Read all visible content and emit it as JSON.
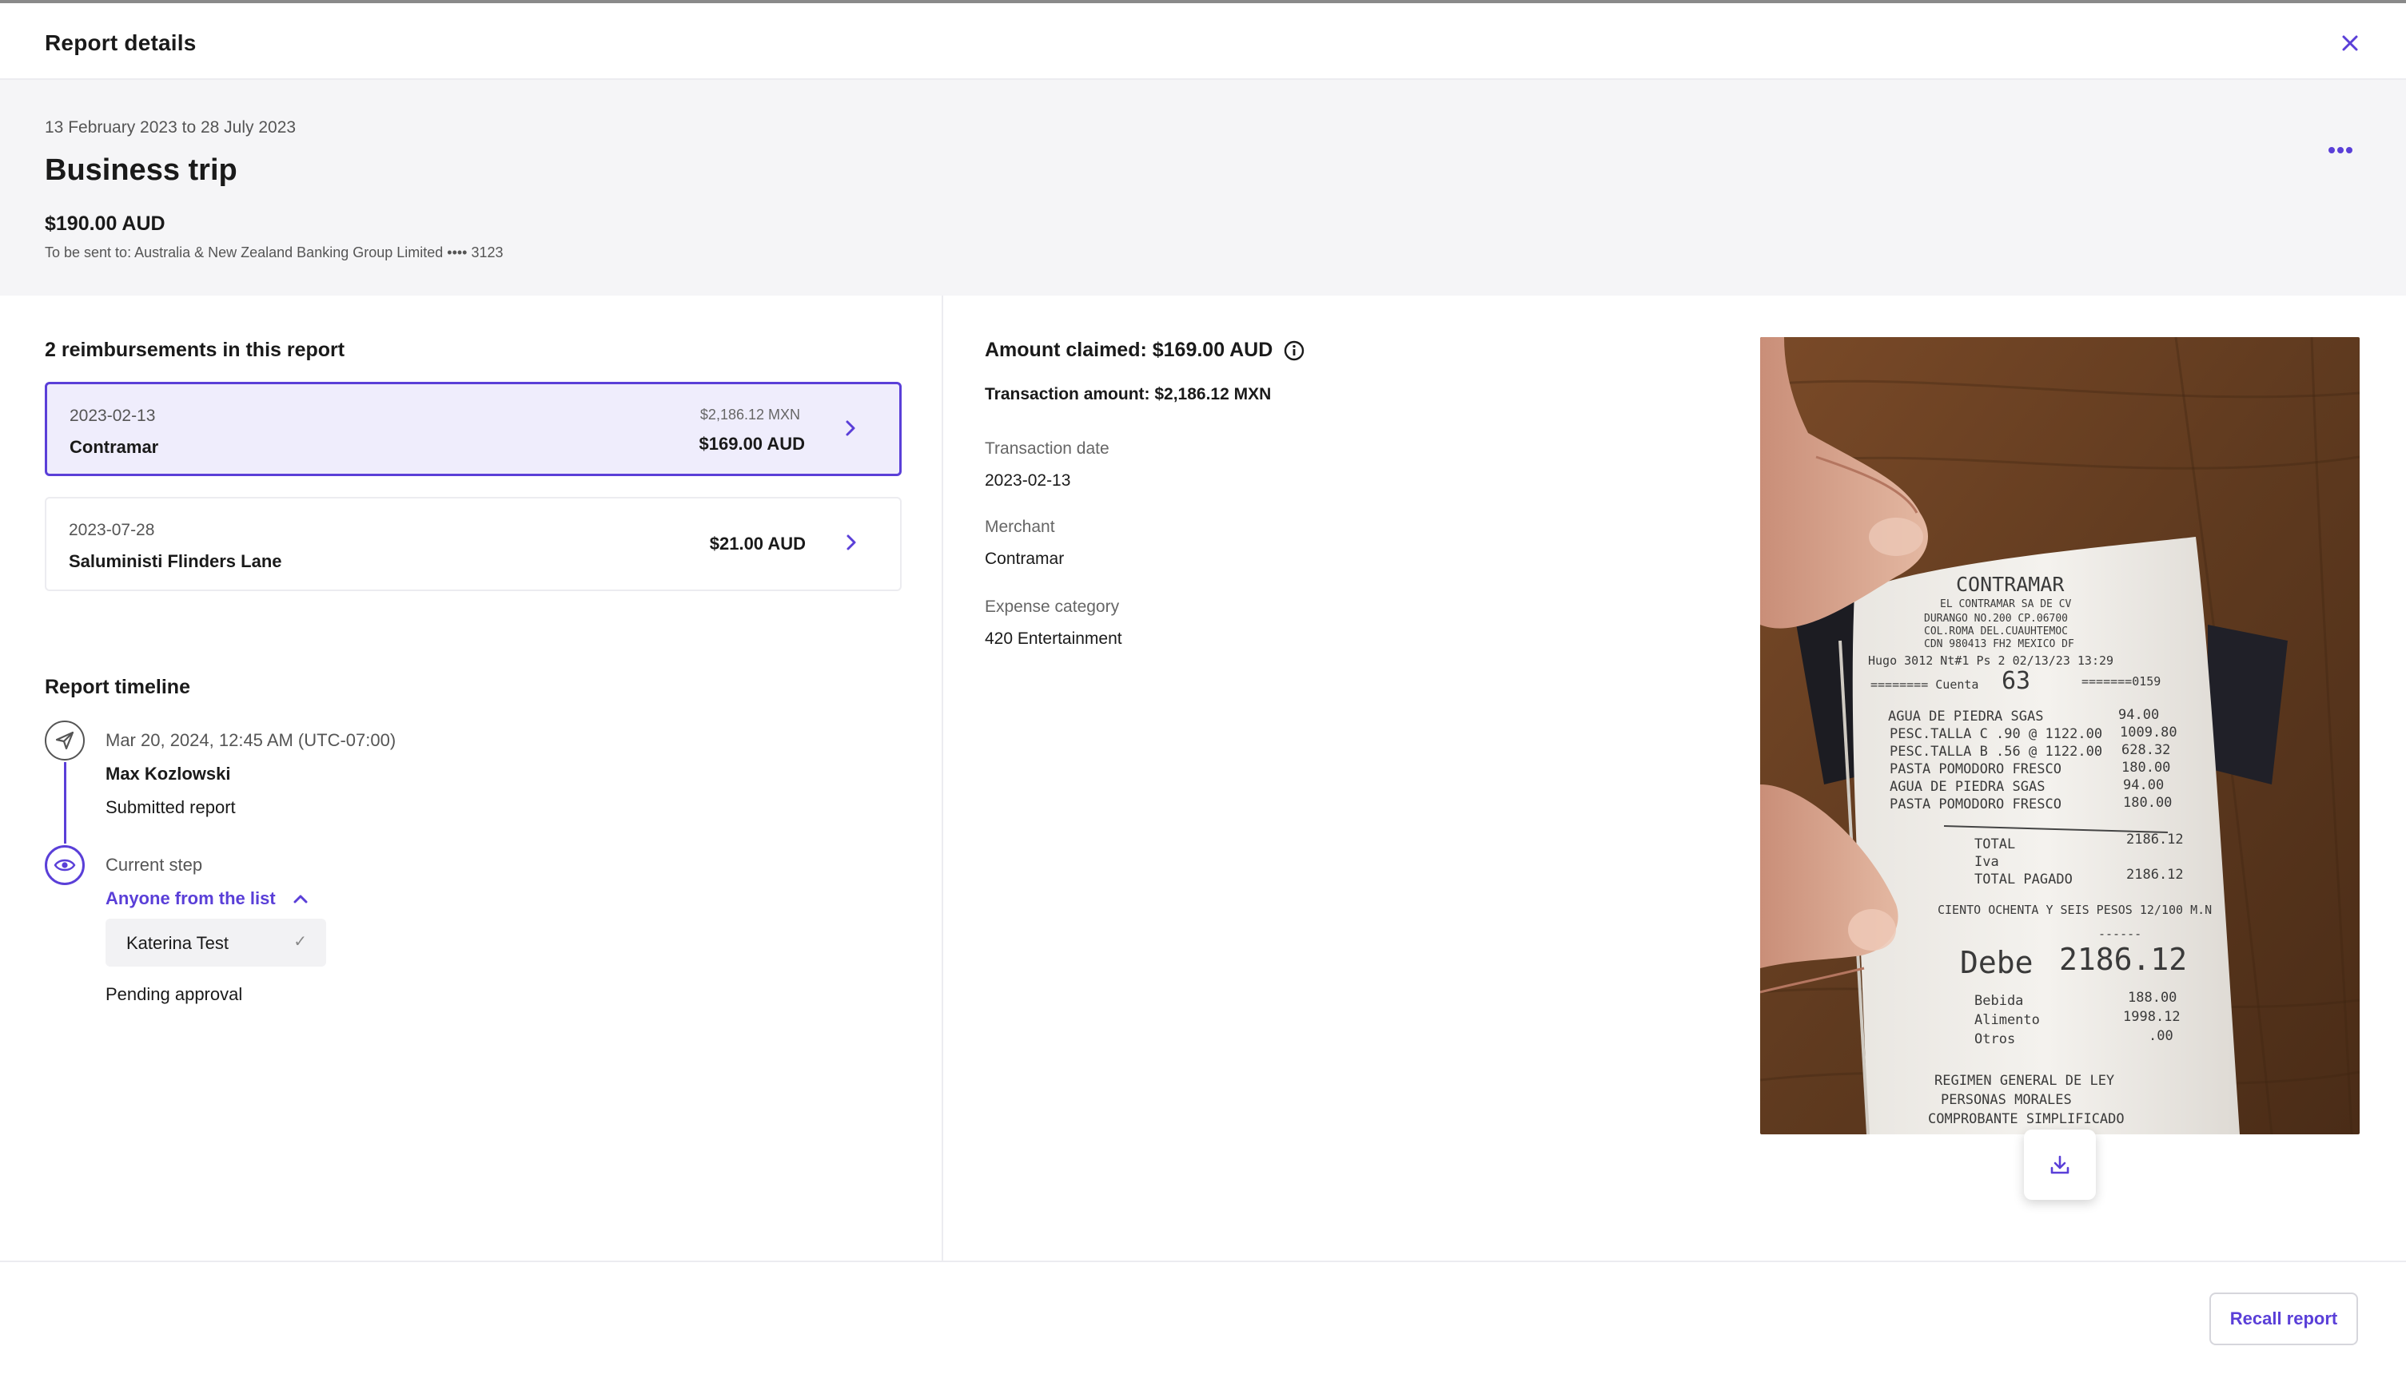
{
  "header": {
    "title": "Report details",
    "close_icon": "close-icon"
  },
  "summary": {
    "date_range": "13 February 2023 to 28 July 2023",
    "report_name": "Business trip",
    "total": "$190.00 AUD",
    "send_to": "To be sent to: Australia & New Zealand Banking Group Limited •••• 3123",
    "more_icon": "more-horizontal-icon"
  },
  "reimbursements": {
    "title": "2 reimbursements in this report",
    "items": [
      {
        "date": "2023-02-13",
        "merchant": "Contramar",
        "original_amount": "$2,186.12 MXN",
        "amount": "$169.00 AUD",
        "selected": true
      },
      {
        "date": "2023-07-28",
        "merchant": "Saluministi Flinders Lane",
        "original_amount": "",
        "amount": "$21.00 AUD",
        "selected": false
      }
    ]
  },
  "timeline": {
    "title": "Report timeline",
    "steps": [
      {
        "icon": "send-icon",
        "timestamp": "Mar 20, 2024, 12:45 AM (UTC-07:00)",
        "actor": "Max Kozlowski",
        "action": "Submitted report"
      },
      {
        "icon": "eye-icon",
        "label": "Current step",
        "approver_group": "Anyone from the list",
        "approvers": [
          "Katerina Test"
        ],
        "status": "Pending approval"
      }
    ]
  },
  "detail": {
    "amount_claimed": "Amount claimed: $169.00 AUD",
    "transaction_amount": "Transaction amount: $2,186.12 MXN",
    "fields": [
      {
        "label": "Transaction date",
        "value": "2023-02-13"
      },
      {
        "label": "Merchant",
        "value": "Contramar"
      },
      {
        "label": "Expense category",
        "value": "420 Entertainment"
      }
    ]
  },
  "receipt": {
    "lines": [
      "CONTRAMAR",
      "EL CONTRAMAR SA DE CV",
      "DURANGO NO.200  CP.06700",
      "COL.ROMA DEL.CUAUHTEMOC",
      "CDN 980413 FH2 MEXICO DF",
      "Hugo   3012  Nt#1 Ps 2  02/13/23  13:29",
      "======== Cuenta",
      "63",
      "=======0159",
      "AGUA DE PIEDRA SGAS",
      "94.00",
      "PESC.TALLA C   .90 @ 1122.00",
      "1009.80",
      "PESC.TALLA B   .56 @ 1122.00",
      "628.32",
      "PASTA POMODORO FRESCO",
      "180.00",
      "AGUA DE PIEDRA SGAS",
      "94.00",
      "PASTA POMODORO FRESCO",
      "180.00",
      "TOTAL",
      "2186.12",
      "Iva",
      "TOTAL PAGADO",
      "2186.12",
      "CIENTO OCHENTA Y SEIS PESOS 12/100 M.N",
      "------",
      "Debe",
      "2186.12",
      "Bebida",
      "188.00",
      "Alimento",
      "1998.12",
      "Otros",
      ".00",
      "REGIMEN GENERAL DE LEY",
      "PERSONAS MORALES",
      "COMPROBANTE SIMPLIFICADO"
    ],
    "download_icon": "download-icon"
  },
  "footer": {
    "recall_label": "Recall report"
  },
  "colors": {
    "accent": "#5a3fd8",
    "selected_bg": "#efedfc",
    "band_bg": "#f5f5f7",
    "wood": "#6b3f22"
  }
}
